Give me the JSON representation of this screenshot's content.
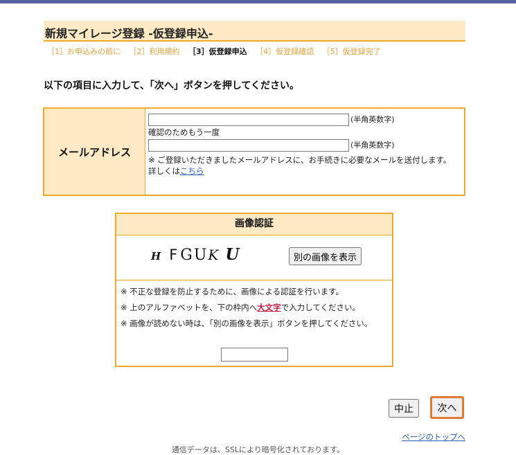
{
  "title": "新規マイレージ登録 -仮登録申込-",
  "steps": [
    {
      "label": "［1］お申込みの前に",
      "active": false
    },
    {
      "label": "［2］利用規約",
      "active": false
    },
    {
      "label": "［3］仮登録申込",
      "active": true
    },
    {
      "label": "［4］仮登録確認",
      "active": false
    },
    {
      "label": "［5］仮登録完了",
      "active": false
    }
  ],
  "instruction": "以下の項目に入力して、「次へ」ボタンを押してください。",
  "email": {
    "label": "メールアドレス",
    "hint1": "(半角英数字)",
    "confirm_label": "確認のためもう一度",
    "hint2": "(半角英数字)",
    "note": "※ ご登録いただきましたメールアドレスに、お手続きに必要なメールを送付します。",
    "detail_prefix": "詳しくは",
    "detail_link": "こちら",
    "value1": "",
    "value2": ""
  },
  "captcha": {
    "header": "画像認証",
    "chars": [
      "H",
      "F",
      "G",
      "U",
      "K",
      "U"
    ],
    "refresh_button": "別の画像を表示",
    "note1": "※ 不正な登録を防止するために、画像による認証を行います。",
    "note2_prefix": "※ 上のアルファベットを、下の枠内へ",
    "note2_emphasis": "大文字",
    "note2_suffix": "で入力してください。",
    "note3": "※ 画像が読めない時は、「別の画像を表示」ボタンを押してください。",
    "input_value": ""
  },
  "buttons": {
    "cancel": "中止",
    "next": "次へ"
  },
  "page_top_link": "ページのトップへ",
  "footer": "通信データは、SSLにより暗号化されております。",
  "colors": {
    "accent": "#f0a92a",
    "header_bg": "#fde9c4",
    "step_inactive": "#e8a33a",
    "link": "#2a60c4",
    "emphasis": "#c4173d",
    "next_border": "#e07a33"
  }
}
